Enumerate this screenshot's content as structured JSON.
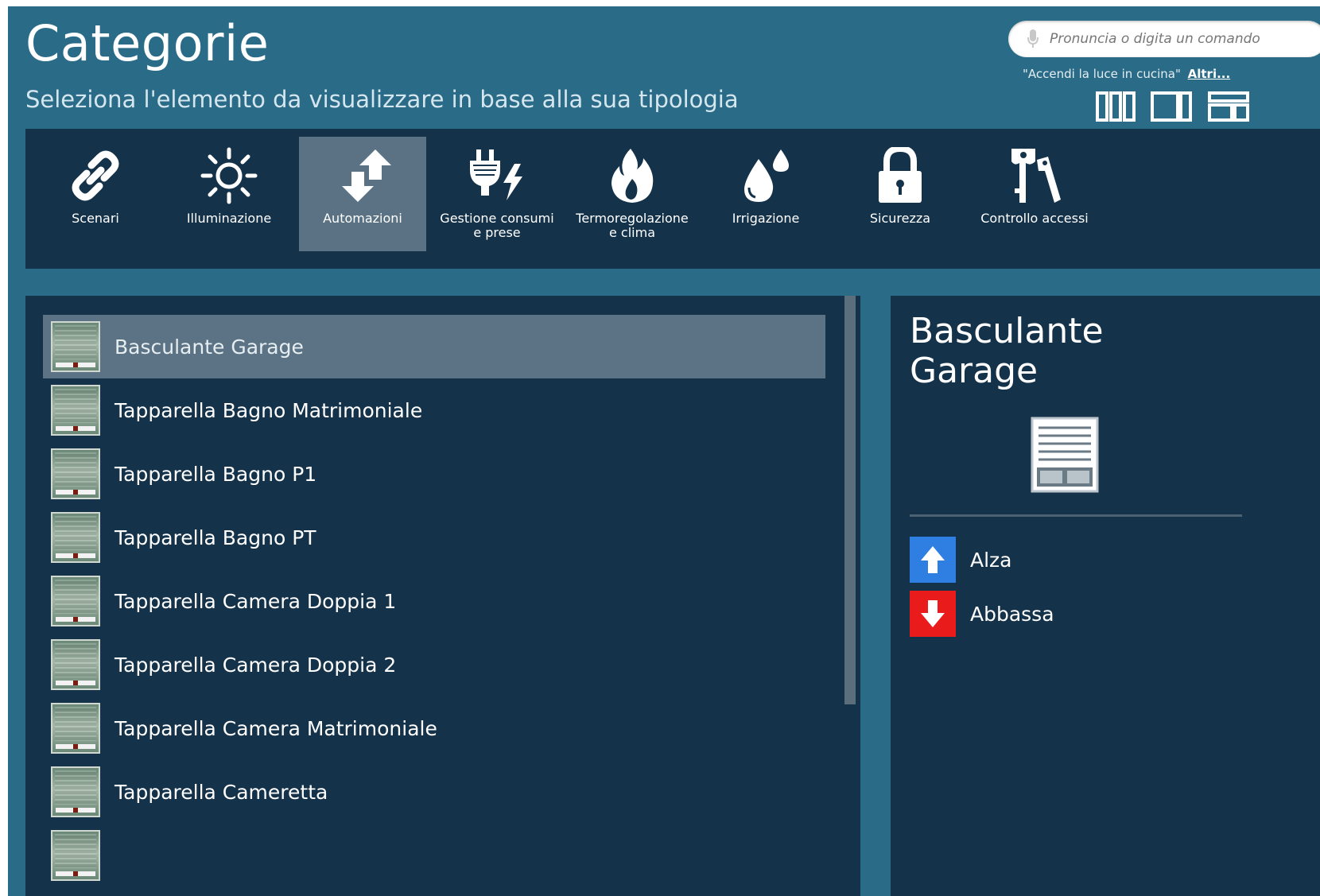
{
  "header": {
    "title": "Categorie",
    "subtitle": "Seleziona l'elemento da visualizzare in base alla sua tipologia"
  },
  "search": {
    "placeholder": "Pronuncia o digita un comando",
    "hint_text": "\"Accendi la luce in cucina\"",
    "hint_link": "Altri..."
  },
  "layout_buttons": [
    "layout-three-columns-icon",
    "layout-two-columns-icon",
    "layout-rows-icon"
  ],
  "categories": [
    {
      "label": "Scenari",
      "icon": "link-icon",
      "active": false
    },
    {
      "label": "Illuminazione",
      "icon": "sun-icon",
      "active": false
    },
    {
      "label": "Automazioni",
      "icon": "arrows-up-down-icon",
      "active": true
    },
    {
      "label": "Gestione consumi\ne prese",
      "icon": "plug-bolt-icon",
      "active": false
    },
    {
      "label": "Termoregolazione\ne clima",
      "icon": "flame-icon",
      "active": false
    },
    {
      "label": "Irrigazione",
      "icon": "water-drops-icon",
      "active": false
    },
    {
      "label": "Sicurezza",
      "icon": "padlock-icon",
      "active": false
    },
    {
      "label": "Controllo accessi",
      "icon": "keys-icon",
      "active": false
    }
  ],
  "list": {
    "items": [
      {
        "label": "Basculante Garage",
        "selected": true
      },
      {
        "label": "Tapparella Bagno Matrimoniale",
        "selected": false
      },
      {
        "label": "Tapparella Bagno P1",
        "selected": false
      },
      {
        "label": "Tapparella Bagno PT",
        "selected": false
      },
      {
        "label": "Tapparella Camera Doppia 1",
        "selected": false
      },
      {
        "label": "Tapparella Camera Doppia 2",
        "selected": false
      },
      {
        "label": "Tapparella Camera Matrimoniale",
        "selected": false
      },
      {
        "label": "Tapparella Cameretta",
        "selected": false
      }
    ]
  },
  "detail": {
    "title": "Basculante Garage",
    "icon": "garage-door-icon",
    "actions": [
      {
        "label": "Alza",
        "icon": "arrow-up-icon",
        "color": "#2f7fe3"
      },
      {
        "label": "Abbassa",
        "icon": "arrow-down-icon",
        "color": "#ea1b1b"
      }
    ]
  },
  "colors": {
    "background": "#2a6b88",
    "panel": "#14324a",
    "active_tile": "#5a7283",
    "selected_row": "#5b7384"
  }
}
